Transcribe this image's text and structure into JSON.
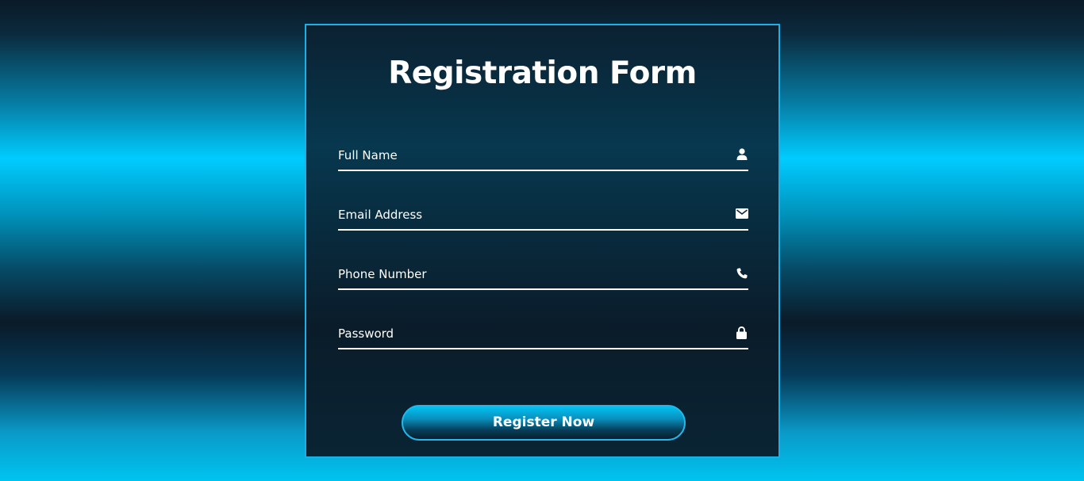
{
  "form": {
    "title": "Registration Form",
    "fields": [
      {
        "label": "Full Name",
        "icon": "user-icon"
      },
      {
        "label": "Email Address",
        "icon": "envelope-icon"
      },
      {
        "label": "Phone Number",
        "icon": "phone-icon"
      },
      {
        "label": "Password",
        "icon": "lock-icon"
      }
    ],
    "submit_label": "Register Now"
  },
  "colors": {
    "accent": "#1ab2e6",
    "bright_cyan": "#00ccff",
    "panel_dark": "#0b2131",
    "text": "#ffffff"
  }
}
